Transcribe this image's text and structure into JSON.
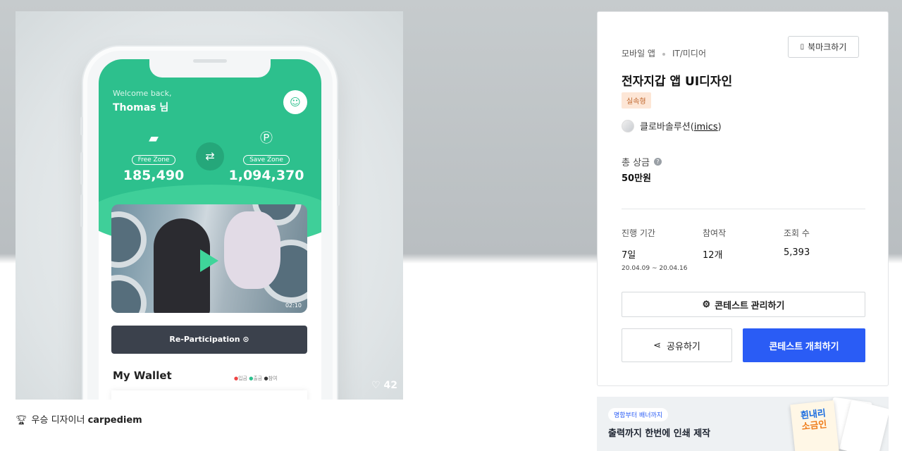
{
  "hero": {
    "likes": "42",
    "app": {
      "welcome": "Welcome back,",
      "name": "Thomas 님",
      "free_zone_label": "Free Zone",
      "free_zone_value": "185,490",
      "save_zone_label": "Save Zone",
      "save_zone_value": "1,094,370",
      "video_time": "02:10",
      "reparticipation": "Re-Participation",
      "wallet_title": "My Wallet",
      "legend": [
        "입금",
        "출금",
        "참여"
      ]
    }
  },
  "winner": {
    "label": "우승 디자이너",
    "designer": "carpediem"
  },
  "panel": {
    "categories": [
      "모바일 앱",
      "IT/미디어"
    ],
    "bookmark_label": "북마크하기",
    "title": "전자지갑 앱 UI디자인",
    "badge": "실속형",
    "host_name": "클로바솔루션",
    "host_id": "imics",
    "prize_label": "총 상금",
    "prize_value": "50만원",
    "stats": {
      "period_label": "진행 기간",
      "period_value": "7일",
      "period_range": "20.04.09 ~ 20.04.16",
      "entries_label": "참여작",
      "entries_value": "12개",
      "views_label": "조회 수",
      "views_value": "5,393"
    },
    "manage_label": "콘테스트 관리하기",
    "share_label": "공유하기",
    "host_contest_label": "콘테스트 개최하기"
  },
  "ad": {
    "pill": "명함부터 배너까지",
    "text": "출력까지 한번에 인쇄 제작",
    "book_line1": "흰내리",
    "book_line2": "소금인"
  },
  "colors": {
    "primary": "#2a5cf5",
    "app_green": "#2dc08d",
    "badge_bg": "#fde6d6",
    "badge_text": "#c0672d"
  }
}
